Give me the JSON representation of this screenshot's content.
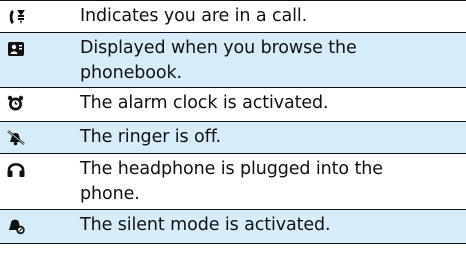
{
  "colors": {
    "row_shade": "#d7ecf9",
    "rule": "#111111",
    "text": "#111111"
  },
  "rows": [
    {
      "icon": "call-icon",
      "text": "Indicates you are in a call."
    },
    {
      "icon": "phonebook-icon",
      "text": "Displayed when you browse the phonebook."
    },
    {
      "icon": "alarm-clock-icon",
      "text": "The alarm clock is activated."
    },
    {
      "icon": "ringer-off-icon",
      "text": "The ringer is off."
    },
    {
      "icon": "headphone-icon",
      "text": "The headphone is plugged into the phone."
    },
    {
      "icon": "silent-mode-icon",
      "text": "The silent mode is activated."
    }
  ]
}
